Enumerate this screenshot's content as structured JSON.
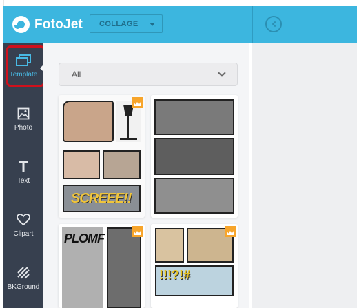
{
  "app": {
    "logo_text": "FotoJet",
    "mode_label": "COLLAGE"
  },
  "colors": {
    "header": "#3cb6df",
    "rail": "#37404f",
    "accent": "#49b9e3",
    "highlight": "#d0101c",
    "premium": "#f7a52b"
  },
  "sidebar": {
    "items": [
      {
        "label": "Template",
        "icon": "template-icon",
        "active": true
      },
      {
        "label": "Photo",
        "icon": "photo-icon"
      },
      {
        "label": "Text",
        "icon": "text-icon"
      },
      {
        "label": "Clipart",
        "icon": "heart-icon"
      },
      {
        "label": "BKGround",
        "icon": "background-icon"
      }
    ]
  },
  "panel": {
    "category_selected": "All",
    "templates": [
      {
        "name": "comic-family",
        "premium": true,
        "caption": "SCREEE!!"
      },
      {
        "name": "comic-bw-group",
        "premium": false
      },
      {
        "name": "comic-splash",
        "premium": true,
        "caption": "PLOMF"
      },
      {
        "name": "comic-beach",
        "premium": true,
        "caption": "!!!?!#"
      }
    ]
  }
}
